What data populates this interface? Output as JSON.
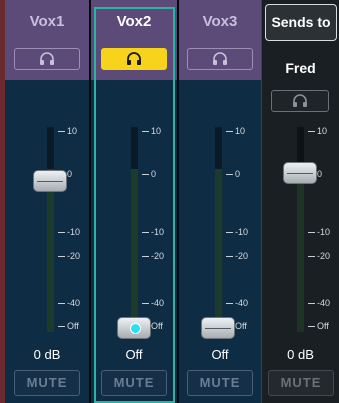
{
  "channels": [
    {
      "name": "Vox1",
      "level": "0 dB",
      "mute_label": "MUTE"
    },
    {
      "name": "Vox2",
      "level": "Off",
      "mute_label": "MUTE"
    },
    {
      "name": "Vox3",
      "level": "Off",
      "mute_label": "MUTE"
    }
  ],
  "scale": {
    "labels": [
      "10",
      "0",
      "-10",
      "-20",
      "-40",
      "Off"
    ]
  },
  "sends": {
    "tab_label": "Sends to",
    "target_name": "Fred",
    "level": "0 dB",
    "mute_label": "MUTE"
  },
  "colors": {
    "header": "#5c4a78",
    "body": "#0f2c45",
    "pfl_active": "#f7d31c",
    "selection": "#2bb3a4"
  },
  "icons": {
    "pfl": "headphones-icon"
  }
}
